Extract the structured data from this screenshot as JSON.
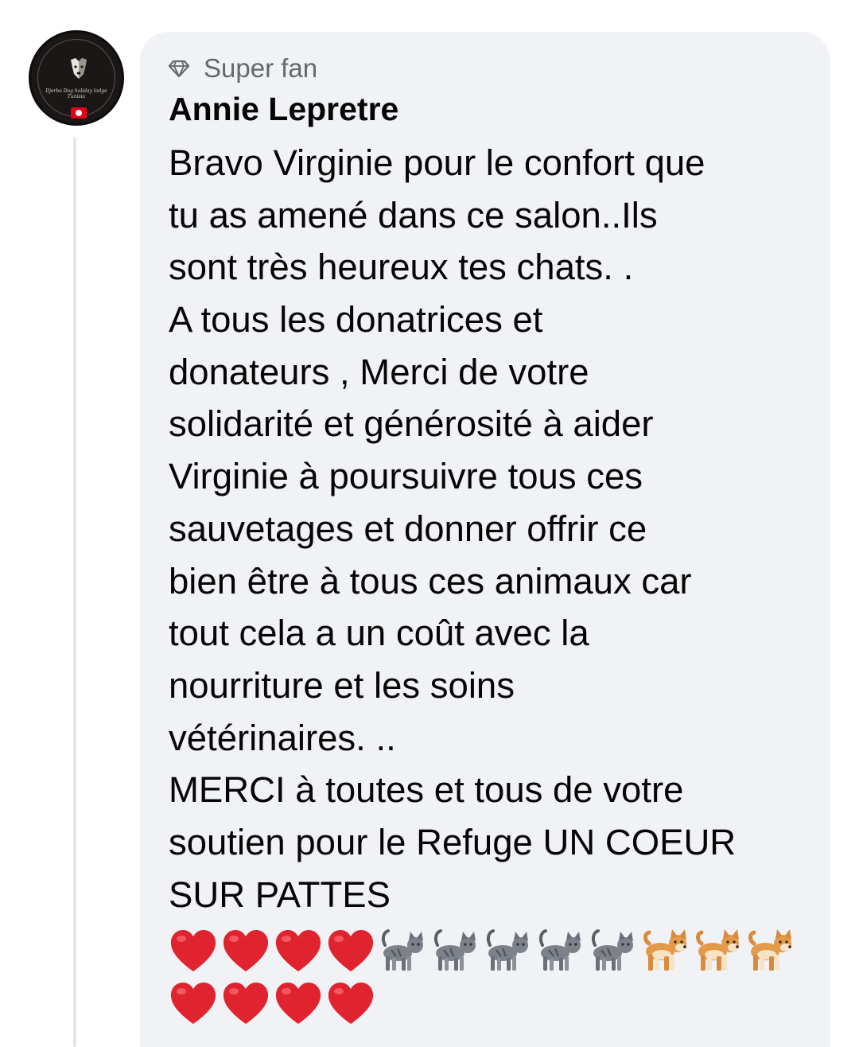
{
  "comment": {
    "badge_label": "Super fan",
    "badge_icon": "diamond-icon",
    "author_name": "Annie Lepretre",
    "avatar": {
      "brand_text": "Djerba Dog holiday lodge Tunisia",
      "flag": "tunisia-flag"
    },
    "lines": [
      "Bravo Virginie pour le confort que",
      "tu as amené dans ce salon..Ils",
      "sont très heureux tes chats. .",
      "A tous les donatrices et",
      "donateurs , Merci de votre",
      "solidarité et générosité à aider",
      "Virginie à poursuivre tous ces",
      "sauvetages et donner offrir ce",
      "bien être à tous ces animaux car",
      "tout cela a un coût avec la",
      "nourriture et les soins",
      "vétérinaires.  ..",
      "MERCI à toutes et tous de votre",
      "soutien pour le Refuge UN COEUR",
      "SUR PATTES"
    ],
    "emoji_rows": [
      [
        "heart",
        "heart",
        "heart",
        "heart",
        "cat",
        "cat",
        "cat",
        "cat",
        "cat",
        "dog",
        "dog",
        "dog"
      ],
      [
        "heart",
        "heart",
        "heart",
        "heart"
      ]
    ]
  },
  "colors": {
    "bubble_bg": "#f0f2f5",
    "text": "#050505",
    "secondary_text": "#65676b",
    "heart": "#e0242f",
    "thread_line": "#e4e6eb"
  }
}
